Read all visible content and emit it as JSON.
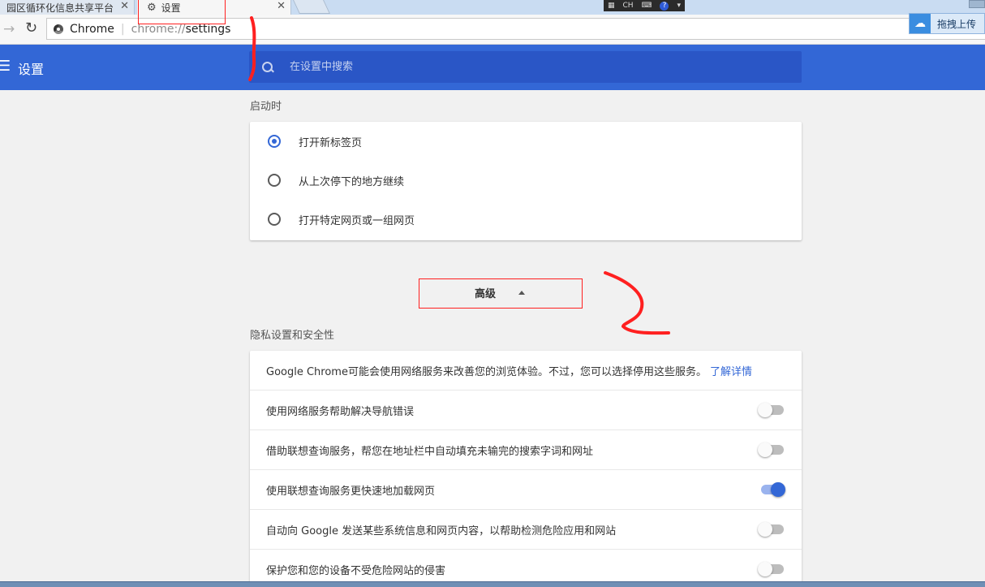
{
  "tabs": [
    {
      "title": "园区循环化信息共享平台",
      "close": "✕"
    },
    {
      "title": "设置",
      "close": "✕"
    }
  ],
  "ime": {
    "label": "CH",
    "help": "?"
  },
  "toolbar": {
    "site_name": "Chrome",
    "url_scheme": "chrome://",
    "url_path": "settings",
    "forward": "→",
    "reload": "↻"
  },
  "baidu_upload": {
    "label": "拖拽上传",
    "icon": "baidu-cloud-icon"
  },
  "header": {
    "menu": "☰",
    "title": "设置",
    "search_placeholder": "在设置中搜索"
  },
  "startup": {
    "title": "启动时",
    "options": [
      {
        "label": "打开新标签页",
        "checked": true
      },
      {
        "label": "从上次停下的地方继续",
        "checked": false
      },
      {
        "label": "打开特定网页或一组网页",
        "checked": false
      }
    ]
  },
  "advanced": {
    "label": "高级"
  },
  "privacy": {
    "title": "隐私设置和安全性",
    "intro": "Google Chrome可能会使用网络服务来改善您的浏览体验。不过，您可以选择停用这些服务。",
    "intro_link": "了解详情",
    "items": [
      {
        "label": "使用网络服务帮助解决导航错误",
        "enabled": false
      },
      {
        "label": "借助联想查询服务，帮您在地址栏中自动填充未输完的搜索字词和网址",
        "enabled": false
      },
      {
        "label": "使用联想查询服务更快速地加载网页",
        "enabled": true
      },
      {
        "label": "自动向 Google 发送某些系统信息和网页内容，以帮助检测危险应用和网站",
        "enabled": false
      },
      {
        "label": "保护您和您的设备不受危险网站的侵害",
        "enabled": false
      }
    ]
  },
  "colors": {
    "accent": "#3367d6",
    "header_bg": "#3367d6",
    "annotation": "#ff2020"
  }
}
